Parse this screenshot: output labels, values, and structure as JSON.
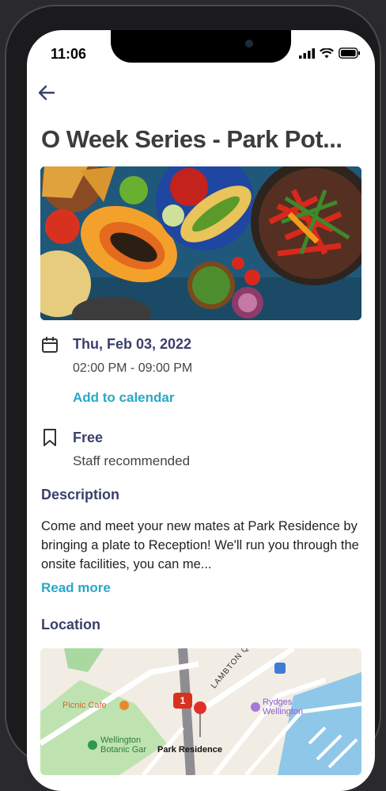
{
  "status_bar": {
    "time": "11:06"
  },
  "event": {
    "title": "O Week Series - Park Pot...",
    "date": "Thu, Feb 03, 2022",
    "time_range": "02:00 PM - 09:00 PM",
    "add_to_calendar": "Add to calendar",
    "price": "Free",
    "tag": "Staff recommended",
    "description_heading": "Description",
    "description": "Come and meet your new mates at Park Residence by bringing a plate to Reception! We'll run you through the onsite facilities, you can me...",
    "read_more": "Read more",
    "location_heading": "Location"
  },
  "map": {
    "labels": {
      "picnic": "Picnic Cafe",
      "street": "LAMBTON QUAY",
      "rydges_1": "Rydges",
      "rydges_2": "Wellington",
      "botanic_1": "Wellington",
      "botanic_2": "Botanic Gar",
      "park": "Park Residence",
      "route": "1"
    }
  },
  "colors": {
    "accent": "#2aa8c4",
    "heading": "#3a3f6b"
  }
}
